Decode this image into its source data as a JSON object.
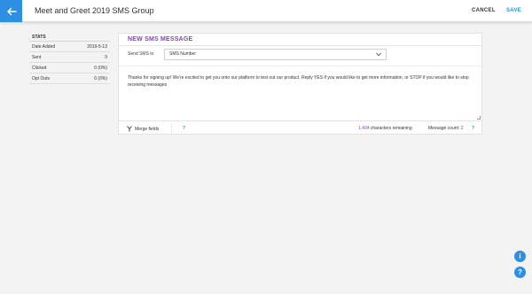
{
  "header": {
    "title": "Meet and Greet 2019 SMS Group",
    "cancel_label": "CANCEL",
    "save_label": "SAVE"
  },
  "stats": {
    "heading": "STATS",
    "rows": [
      {
        "label": "Date Added",
        "value": "2019-5-13"
      },
      {
        "label": "Sent",
        "value": "0"
      },
      {
        "label": "Clicked",
        "value": "0 (0%)"
      },
      {
        "label": "Opt Outs",
        "value": "0 (0%)"
      }
    ]
  },
  "composer": {
    "heading": "NEW SMS MESSAGE",
    "send_to_label": "Send SMS to",
    "send_to_value": "SMS Number",
    "message": "Thanks for signing up! We're excited to get you onto our platform to test out our product. Reply YES if you would like to get more information, or STOP if you would like to stop receiving messages",
    "merge_fields_label": "Merge fields",
    "help_glyph": "?",
    "chars_remaining_number": "1,404",
    "chars_remaining_text": "characters remaining",
    "message_count_label": "Message count:",
    "message_count_value": "2"
  },
  "floating": {
    "info_glyph": "i",
    "help_glyph": "?"
  },
  "colors": {
    "accent_blue": "#2c8fe3",
    "accent_purple": "#8c3fbf"
  }
}
